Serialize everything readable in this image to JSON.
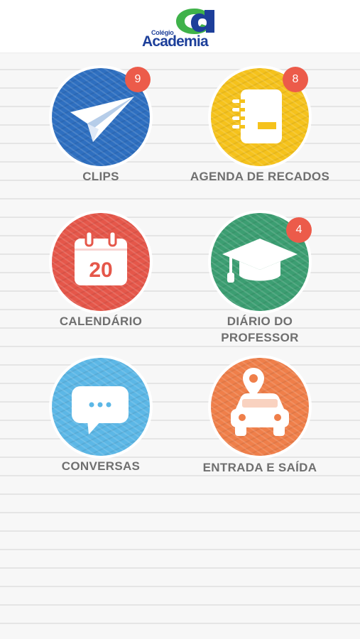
{
  "header": {
    "logo_small": "Colégio",
    "logo_big": "Academia"
  },
  "menu": [
    {
      "label": "CLIPS",
      "badge": "9",
      "color": "#2e6fc0",
      "icon": "paper-plane-icon"
    },
    {
      "label": "AGENDA DE RECADOS",
      "badge": "8",
      "color": "#f5c21c",
      "icon": "notebook-icon"
    },
    {
      "label": "CALENDÁRIO",
      "badge": "",
      "icon_text": "20",
      "color": "#e5574a",
      "icon": "calendar-icon"
    },
    {
      "label": "DIÁRIO DO PROFESSOR",
      "label_line1": "DIÁRIO DO",
      "label_line2": "PROFESSOR",
      "badge": "4",
      "color": "#3c9e72",
      "icon": "graduation-cap-icon"
    },
    {
      "label": "CONVERSAS",
      "badge": "",
      "color": "#5cb7e6",
      "icon": "chat-bubble-icon"
    },
    {
      "label": "ENTRADA E SAÍDA",
      "badge": "",
      "color": "#ef7f4a",
      "icon": "car-location-icon"
    }
  ],
  "colors": {
    "badge": "#ec5b4a",
    "label": "#6f6f6f",
    "logo_blue": "#1d3f9a",
    "logo_green": "#3fb24a"
  }
}
